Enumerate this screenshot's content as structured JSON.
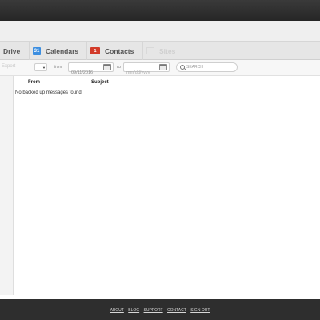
{
  "tabs": [
    {
      "label": "Drive"
    },
    {
      "label": "Calendars",
      "icon_text": "31"
    },
    {
      "label": "Contacts",
      "icon_text": "1"
    },
    {
      "label": "Sites"
    }
  ],
  "toolbar": {
    "export_label": "Export",
    "from_label": "from",
    "from_value": "09/11/2016",
    "to_label": "TO",
    "to_placeholder": "mm/dd/yyyy",
    "search_placeholder": "SEARCH"
  },
  "table": {
    "columns": [
      "From",
      "Subject"
    ],
    "empty_message": "No backed up messages found."
  },
  "footer": {
    "links": [
      "ABOUT",
      "BLOG",
      "SUPPORT",
      "CONTACT",
      "SIGN OUT"
    ]
  },
  "colors": {
    "calendar_icon": "#3c8ee0",
    "contacts_icon": "#d23b2a",
    "footer_bg": "#2e2e2e"
  }
}
